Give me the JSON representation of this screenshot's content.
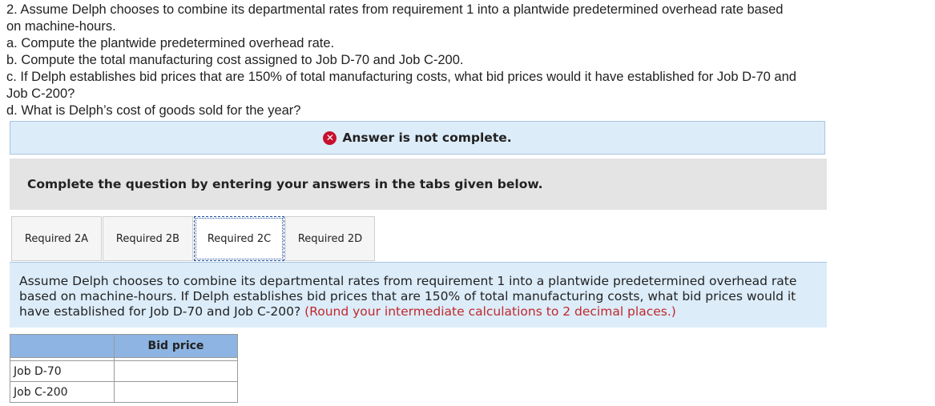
{
  "question": {
    "line1": "2. Assume Delph chooses to combine its departmental rates from requirement 1 into a plantwide predetermined overhead rate based",
    "line2": "on machine-hours.",
    "part_a": "a. Compute the plantwide predetermined overhead rate.",
    "part_b": "b. Compute the total manufacturing cost assigned to Job D-70 and Job C-200.",
    "part_c1": "c. If Delph establishes bid prices that are 150% of total manufacturing costs, what bid prices would it have established for Job D-70 and",
    "part_c2": "Job C-200?",
    "part_d": "d. What is Delph’s cost of goods sold for the year?"
  },
  "status": {
    "text": "Answer is not complete.",
    "icon": "x-circle-icon",
    "icon_glyph": "✕",
    "color": "#c8102e"
  },
  "instruction": "Complete the question by entering your answers in the tabs given below.",
  "tabs": [
    {
      "label": "Required 2A"
    },
    {
      "label": "Required 2B"
    },
    {
      "label": "Required 2C"
    },
    {
      "label": "Required 2D"
    }
  ],
  "active_tab": "Required 2C",
  "panel": {
    "text": "Assume Delph chooses to combine its departmental rates from requirement 1 into a plantwide predetermined overhead rate based on machine-hours. If Delph establishes bid prices that are 150% of total manufacturing costs, what bid prices would it have established for Job D-70 and Job C-200?",
    "hint": "(Round your intermediate calculations to 2 decimal places.)"
  },
  "table": {
    "column_header": "Bid price",
    "rows": [
      {
        "label": "Job D-70",
        "value": ""
      },
      {
        "label": "Job C-200",
        "value": ""
      }
    ]
  }
}
